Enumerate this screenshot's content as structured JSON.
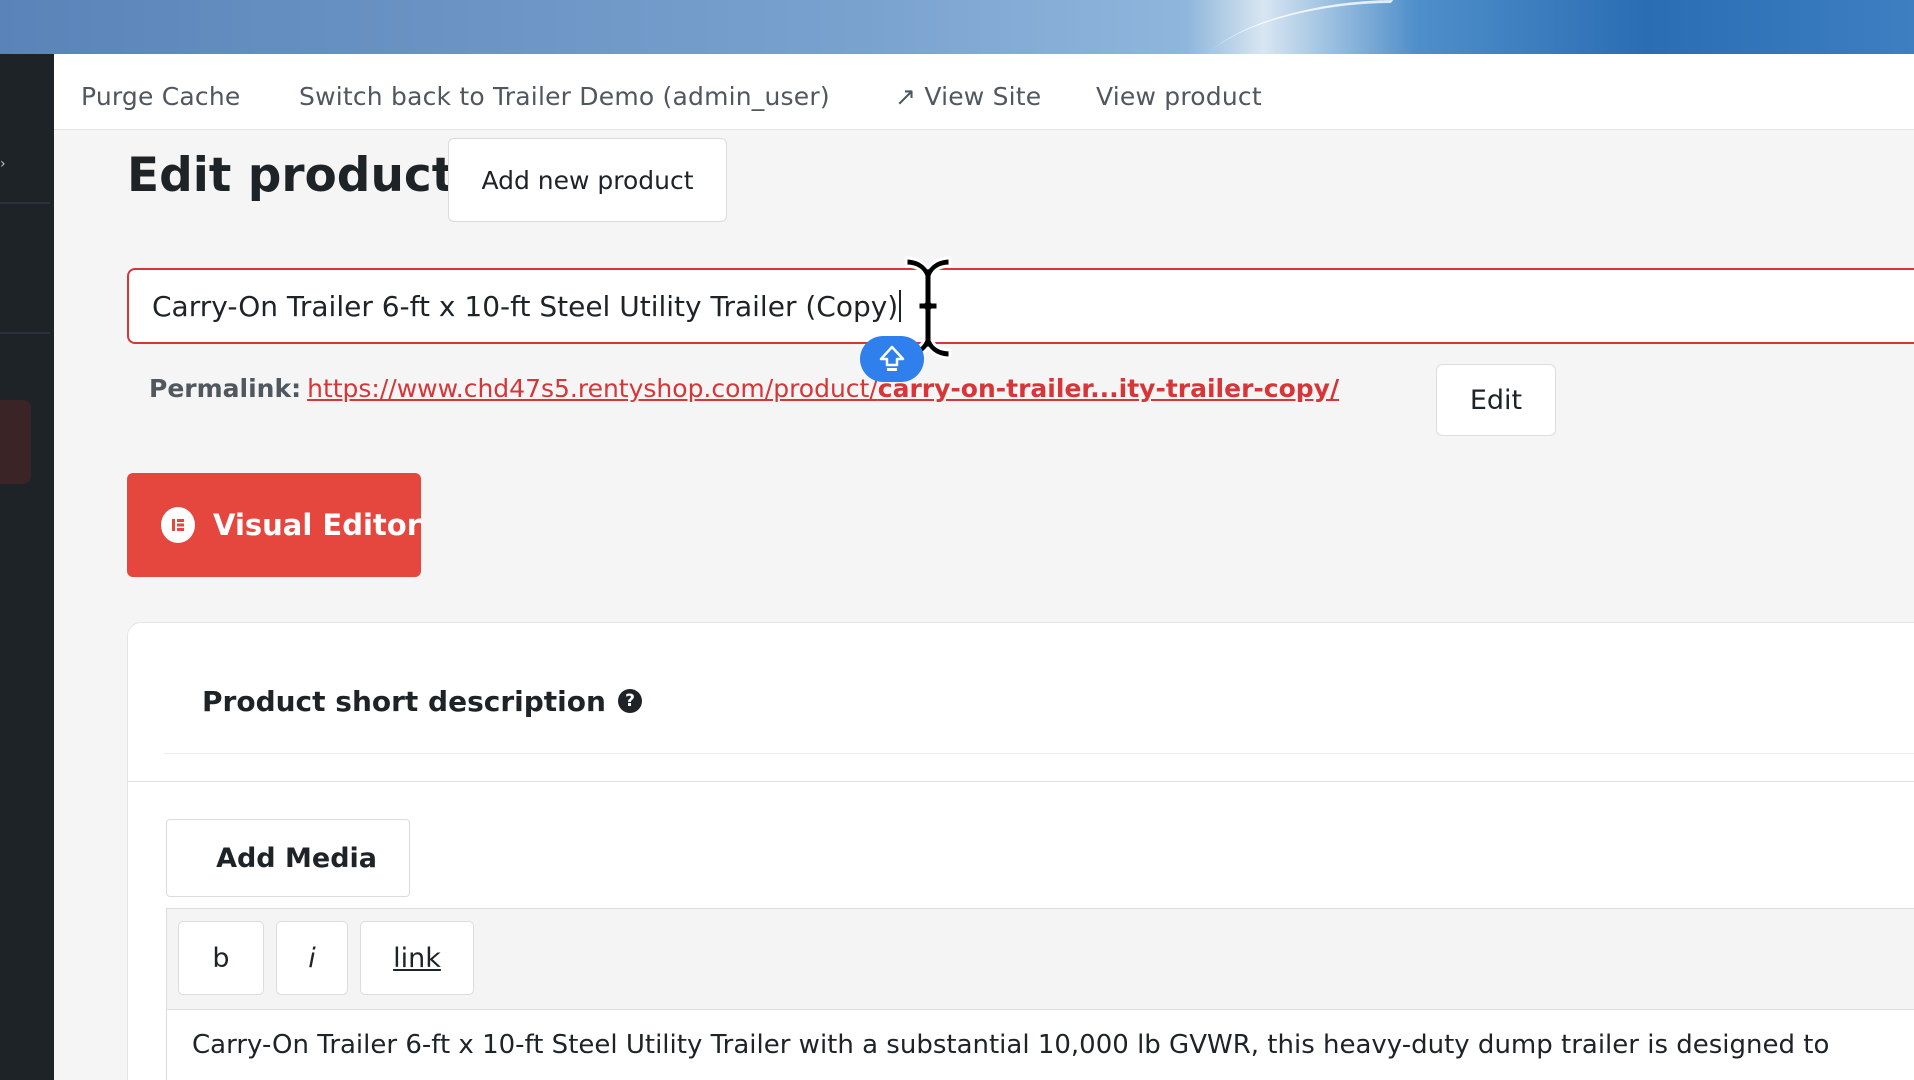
{
  "adminbar": {
    "purge_cache": "Purge Cache",
    "switch_back": "Switch back to Trailer Demo (admin_user)",
    "view_site_arrow": "↗",
    "view_site": "View Site",
    "view_product": "View product"
  },
  "header": {
    "title": "Edit product",
    "add_new": "Add new product"
  },
  "product": {
    "title_value": "Carry-On Trailer 6-ft x 10-ft Steel Utility Trailer (Copy)",
    "permalink_label": "Permalink:",
    "permalink_base": "https://www.chd47s5.rentyshop.com/product/",
    "permalink_slug": "carry-on-trailer...ity-trailer-copy/",
    "permalink_edit": "Edit"
  },
  "visual_editor": {
    "label": "Visual Editor",
    "icon": "elementor-icon"
  },
  "short_description": {
    "title": "Product short description",
    "help_icon": "?",
    "add_media": "Add Media",
    "toolbar": {
      "bold": "b",
      "italic": "i",
      "link": "link"
    },
    "content": "Carry-On Trailer 6-ft x 10-ft Steel Utility Trailer with a substantial 10,000 lb GVWR, this heavy-duty dump trailer is designed to"
  },
  "colors": {
    "accent_red": "#e5473f",
    "link_red": "#d63638",
    "sidebar_dark": "#1d2327",
    "badge_blue": "#2f80ed"
  },
  "icons": [
    "elementor-icon",
    "help-icon",
    "external-arrow-icon",
    "text-cursor-icon",
    "shift-key-icon"
  ]
}
